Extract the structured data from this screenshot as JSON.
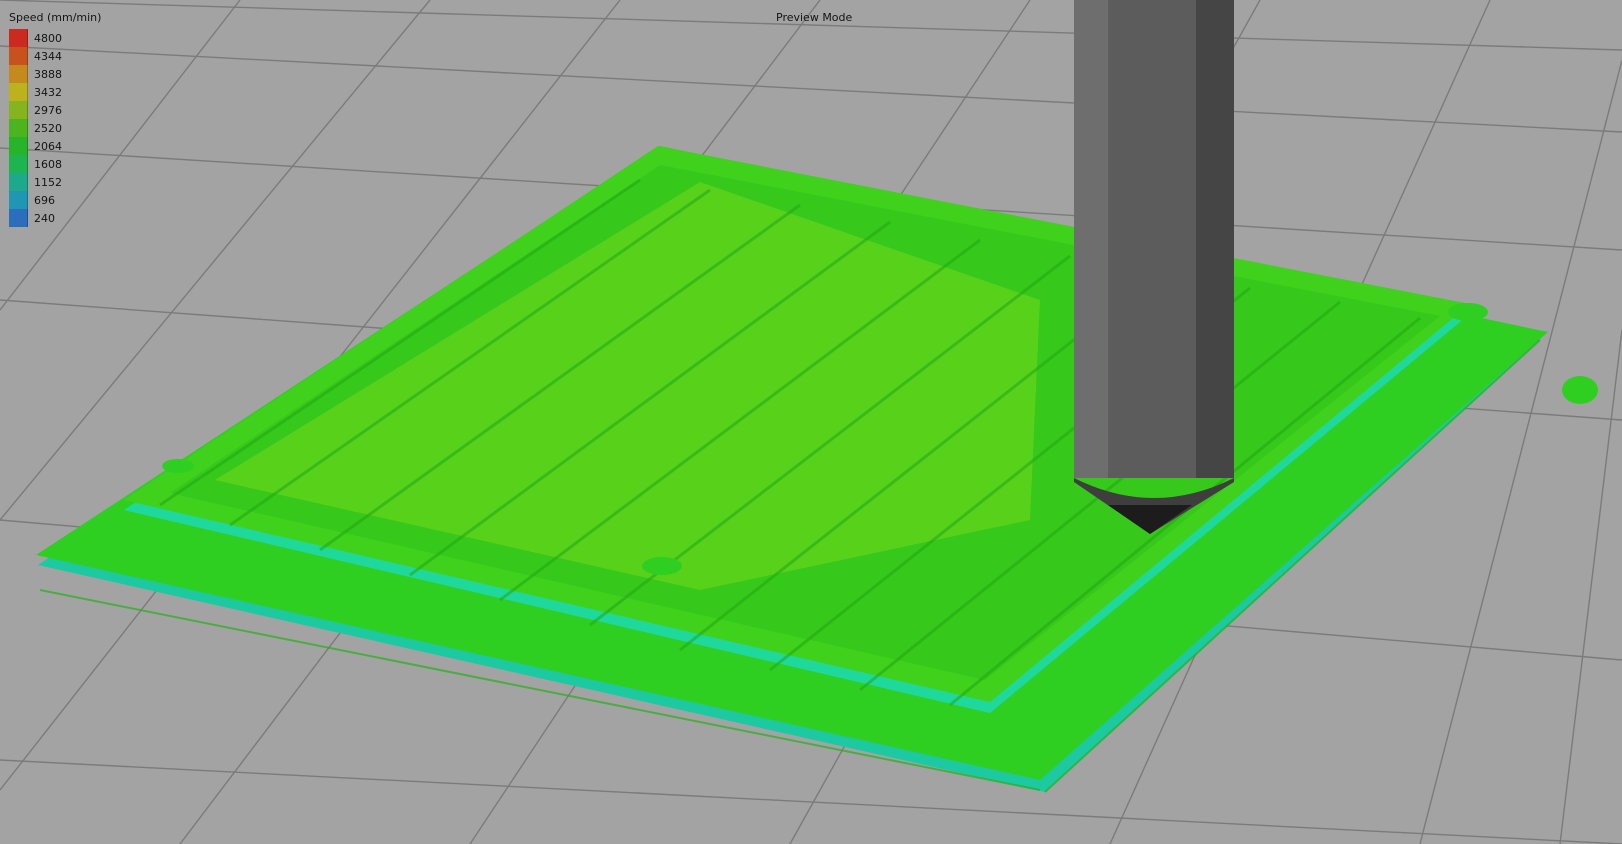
{
  "viewport": {
    "mode_label": "Preview Mode"
  },
  "legend": {
    "title": "Speed (mm/min)",
    "items": [
      {
        "label": "4800",
        "color": "#cc2a1e"
      },
      {
        "label": "4344",
        "color": "#c8521e"
      },
      {
        "label": "3888",
        "color": "#c48a1e"
      },
      {
        "label": "3432",
        "color": "#bcb21e"
      },
      {
        "label": "2976",
        "color": "#86b41e"
      },
      {
        "label": "2520",
        "color": "#4cb41e"
      },
      {
        "label": "2064",
        "color": "#28b42a"
      },
      {
        "label": "1608",
        "color": "#1eb450"
      },
      {
        "label": "1152",
        "color": "#1ea88c"
      },
      {
        "label": "696",
        "color": "#1e96b4"
      },
      {
        "label": "240",
        "color": "#2a6ebc"
      }
    ]
  },
  "colors": {
    "background": "#a3a3a3",
    "grid": "#7a7a7a",
    "perimeter": "#1fd79a",
    "infill": "#38d41e",
    "top_infill": "#62e01a",
    "nozzle": "#5a5a5a"
  }
}
